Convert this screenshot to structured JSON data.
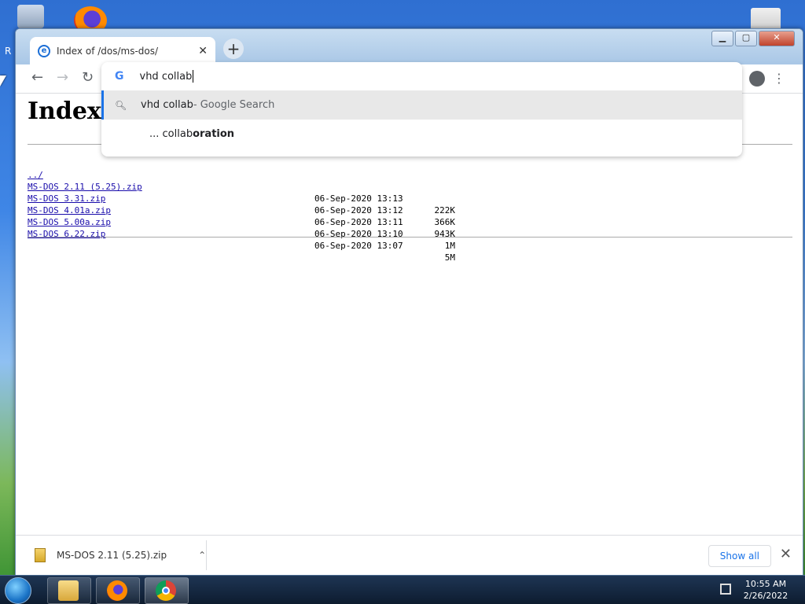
{
  "desktop": {
    "edge_label": "R"
  },
  "browser": {
    "tab": {
      "title": "Index of /dos/ms-dos/"
    },
    "new_tab_symbol": "+",
    "window_controls": {
      "minimize": "▁",
      "maximize": "▢",
      "close": "✕"
    },
    "nav": {
      "back": "←",
      "forward": "→",
      "reload": "↻"
    }
  },
  "omnibox": {
    "typed": "vhd collab",
    "suggestions": [
      {
        "icon": "search-icon",
        "main": "vhd collab",
        "suffix": " - Google Search"
      },
      {
        "prefix": "... collab",
        "bold": "oration"
      }
    ]
  },
  "page": {
    "heading": "Index of /dos/ms-dos/",
    "parent_link": "../",
    "files": [
      {
        "name": "MS-DOS 2.11 (5.25).zip",
        "date": "06-Sep-2020 13:13",
        "size": "222K"
      },
      {
        "name": "MS-DOS 3.31.zip",
        "date": "06-Sep-2020 13:12",
        "size": "366K"
      },
      {
        "name": "MS-DOS 4.01a.zip",
        "date": "06-Sep-2020 13:11",
        "size": "943K"
      },
      {
        "name": "MS-DOS 5.00a.zip",
        "date": "06-Sep-2020 13:10",
        "size": "1M"
      },
      {
        "name": "MS-DOS 6.22.zip",
        "date": "06-Sep-2020 13:07",
        "size": "5M"
      }
    ]
  },
  "download_shelf": {
    "file_name": "MS-DOS 2.11 (5.25).zip",
    "show_all": "Show all",
    "close": "✕"
  },
  "taskbar": {
    "time": "10:55 AM",
    "date": "2/26/2022"
  }
}
